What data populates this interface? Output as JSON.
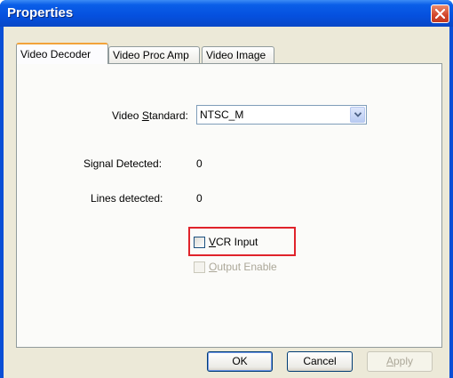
{
  "window": {
    "title": "Properties"
  },
  "tabs": [
    {
      "label": "Video Decoder",
      "active": true
    },
    {
      "label": "Video Proc Amp",
      "active": false
    },
    {
      "label": "Video Image",
      "active": false
    }
  ],
  "video_standard": {
    "label_prefix": "Video ",
    "label_access": "S",
    "label_suffix": "tandard:",
    "value": "NTSC_M"
  },
  "signal_detected": {
    "label": "Signal Detected:",
    "value": "0"
  },
  "lines_detected": {
    "label": "Lines detected:",
    "value": "0"
  },
  "vcr_input": {
    "access": "V",
    "rest": "CR Input",
    "checked": false
  },
  "output_enable": {
    "access": "O",
    "rest": "utput Enable",
    "checked": false,
    "enabled": false
  },
  "buttons": {
    "ok": "OK",
    "cancel": "Cancel",
    "apply_access": "A",
    "apply_rest": "pply"
  },
  "colors": {
    "titlebar": "#0550de",
    "highlight": "#e0232b",
    "face": "#ece9d8"
  }
}
